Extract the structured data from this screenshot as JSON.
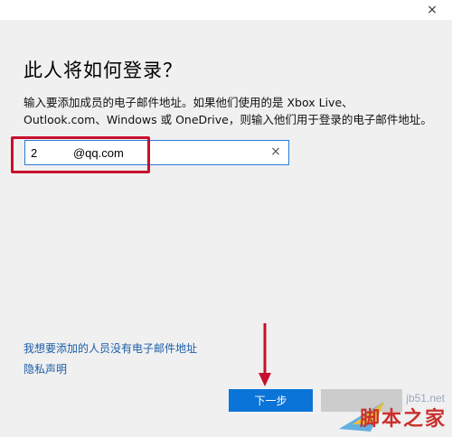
{
  "window": {
    "close_glyph": "×"
  },
  "heading": "此人将如何登录？",
  "description": "输入要添加成员的电子邮件地址。如果他们使用的是 Xbox Live、Outlook.com、Windows 或 OneDrive，则输入他们用于登录的电子邮件地址。",
  "email": {
    "value": "2           @qq.com",
    "clear_glyph": "×"
  },
  "links": {
    "no_email": "我想要添加的人员没有电子邮件地址",
    "privacy": "隐私声明"
  },
  "buttons": {
    "next": "下一步",
    "back": ""
  },
  "watermark": {
    "url": "jb51.net",
    "name": "脚本之家"
  },
  "colors": {
    "accent": "#0a74d8",
    "annotation": "#c8102e",
    "link": "#1a5ea8"
  },
  "icons": [
    "close-icon",
    "clear-icon",
    "annotation-arrow"
  ]
}
